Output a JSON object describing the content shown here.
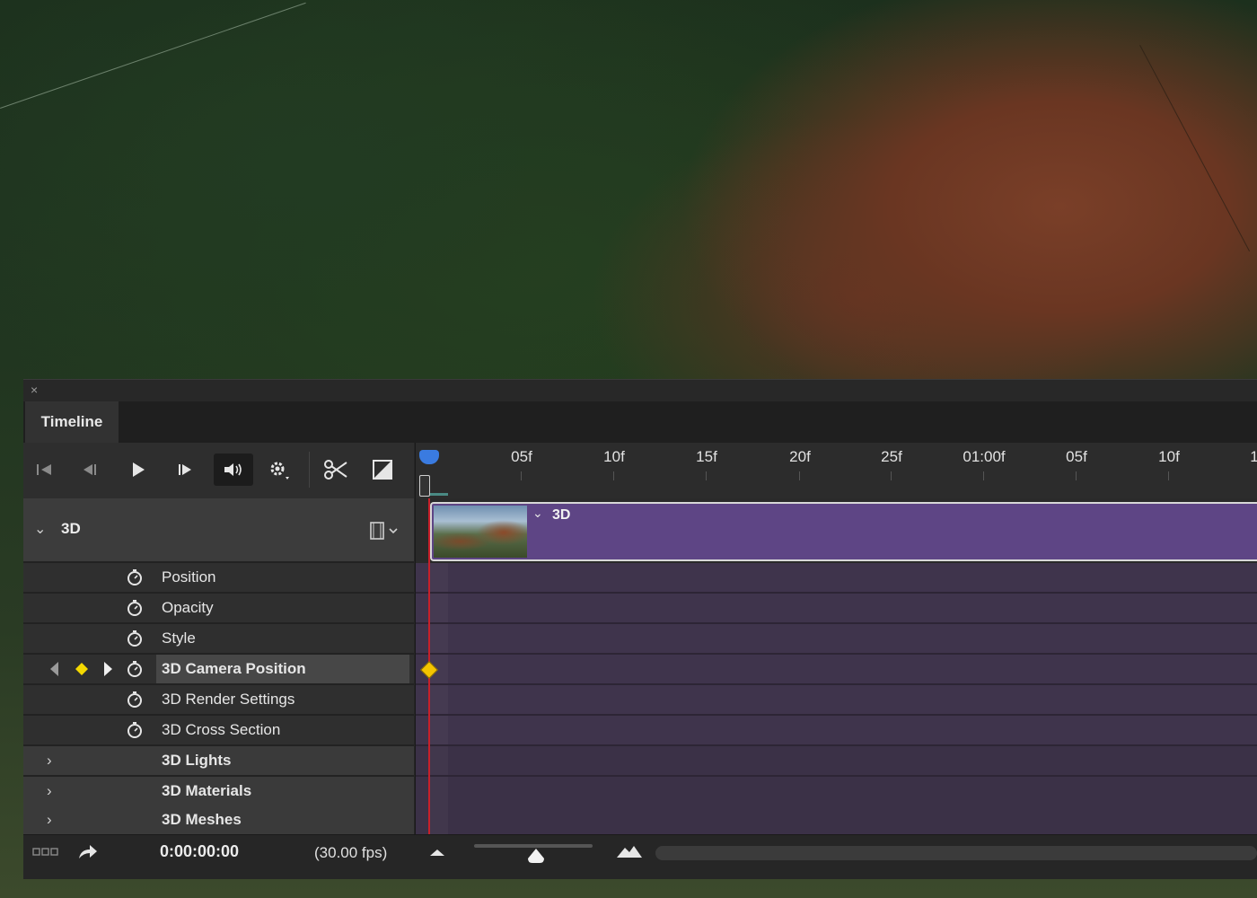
{
  "panel": {
    "title": "Timeline",
    "close_icon": "×"
  },
  "ruler": {
    "labels": [
      "05f",
      "10f",
      "15f",
      "20f",
      "25f",
      "01:00f",
      "05f",
      "10f",
      "1"
    ]
  },
  "layer": {
    "name": "3D",
    "clip_label": "3D"
  },
  "properties": [
    {
      "label": "Position"
    },
    {
      "label": "Opacity"
    },
    {
      "label": "Style"
    },
    {
      "label": "3D Camera Position"
    },
    {
      "label": "3D Render Settings"
    },
    {
      "label": "3D Cross Section"
    }
  ],
  "groups": [
    {
      "label": "3D Lights"
    },
    {
      "label": "3D Materials"
    },
    {
      "label": "3D Meshes"
    }
  ],
  "status": {
    "timecode": "0:00:00:00",
    "fps": "(30.00 fps)"
  },
  "colors": {
    "clip": "#5e4585",
    "track": "#3f344c",
    "playhead": "#c8202a",
    "keyframe": "#f4c400",
    "current_time_indicator": "#3a7be0"
  }
}
